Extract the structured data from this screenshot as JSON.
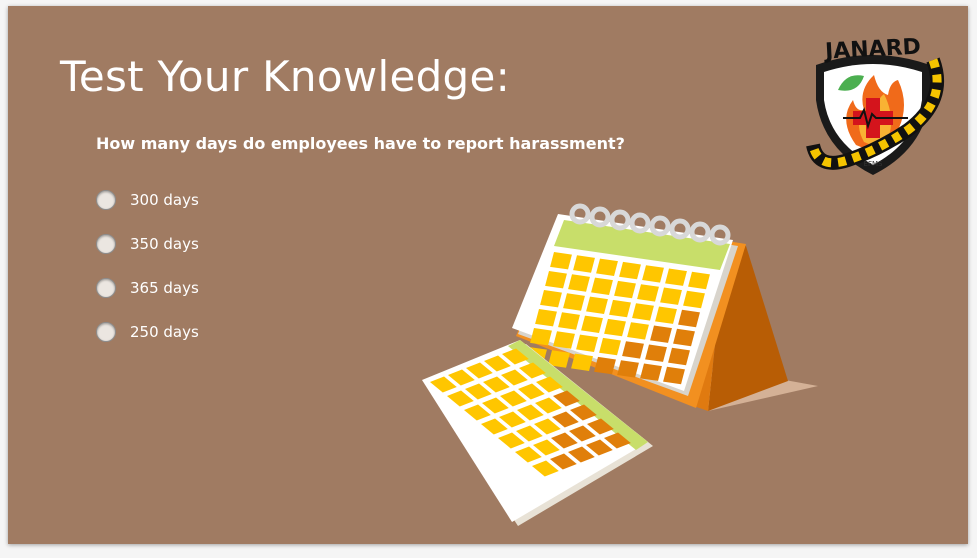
{
  "slide": {
    "title": "Test Your Knowledge:",
    "question": "How many days do employees have to report harassment?",
    "options": [
      {
        "label": "300 days",
        "selected": false
      },
      {
        "label": "350 days",
        "selected": false
      },
      {
        "label": "365 days",
        "selected": false
      },
      {
        "label": "250 days",
        "selected": false
      }
    ]
  },
  "logo": {
    "text": "JANARD",
    "subtext": "EFMS"
  },
  "colors": {
    "background": "#a07b62",
    "text": "#ffffff",
    "calendar_orange": "#f08a1c",
    "calendar_yellow": "#ffcc00",
    "calendar_green": "#c8de6a"
  },
  "icons": {
    "calendar": "calendar-illustration",
    "logo": "janard-shield-logo"
  }
}
